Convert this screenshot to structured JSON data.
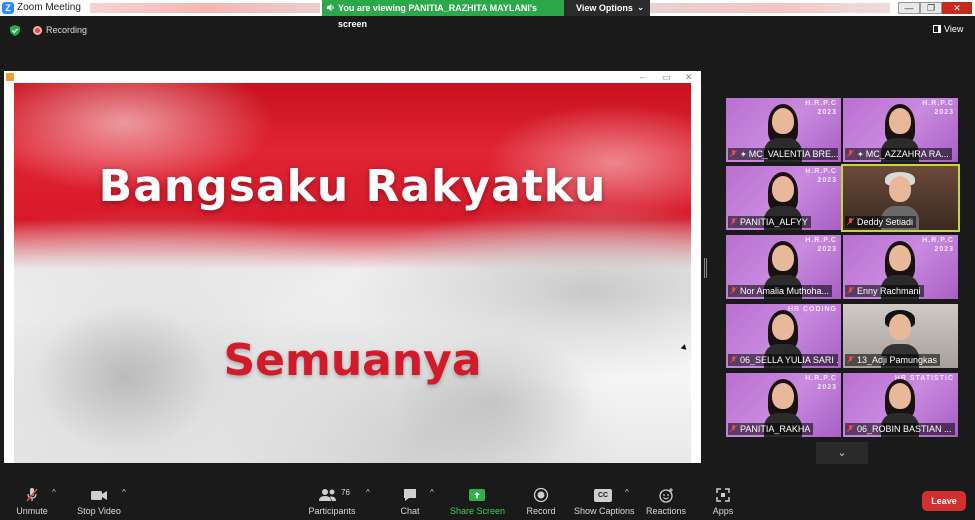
{
  "window": {
    "title": "Zoom Meeting",
    "logo_letter": "Z",
    "viewing_banner": "You are viewing PANITIA_RAZHITA MAYLANI's screen",
    "view_options": "View Options",
    "controls": {
      "minimize": "—",
      "restore": "❐",
      "close": "✕"
    }
  },
  "status": {
    "recording": "Recording",
    "view": "View"
  },
  "shared_screen": {
    "window_controls": {
      "minimize": "–",
      "restore": "▭",
      "close": "✕"
    },
    "headline": "Bangsaku Rakyatku",
    "subline": "Semuanya"
  },
  "gallery": [
    {
      "name": "MC_VALENTIA BRE...",
      "muted": true,
      "pinned": true,
      "mark": "H.R.P.C\n2023",
      "bg": "purple"
    },
    {
      "name": "MC_AZZAHRA RA...",
      "muted": true,
      "pinned": true,
      "mark": "H.R.P.C\n2023",
      "bg": "purple"
    },
    {
      "name": "PANITIA_ALFYY",
      "muted": true,
      "pinned": false,
      "mark": "H.R.P.C\n2023",
      "bg": "purple"
    },
    {
      "name": "Deddy Setiadi",
      "muted": true,
      "pinned": false,
      "mark": "",
      "bg": "real",
      "active_speaker": true
    },
    {
      "name": "Nor Amalia Muthoha...",
      "muted": true,
      "pinned": false,
      "mark": "H.R.P.C\n2023",
      "bg": "purple"
    },
    {
      "name": "Enny Rachmani",
      "muted": true,
      "pinned": false,
      "mark": "H.R.P.C\n2023",
      "bg": "purple"
    },
    {
      "name": "06_SELLA YULIA SARI ...",
      "muted": true,
      "pinned": false,
      "mark": "HR CODING",
      "bg": "purple"
    },
    {
      "name": "13_Adji Pamungkas",
      "muted": true,
      "pinned": false,
      "mark": "",
      "bg": "real2"
    },
    {
      "name": "PANITIA_RAKHA",
      "muted": true,
      "pinned": false,
      "mark": "H.R.P.C\n2023",
      "bg": "purple"
    },
    {
      "name": "06_ROBIN BASTIAN ...",
      "muted": true,
      "pinned": false,
      "mark": "HR STATISTIC",
      "bg": "purple"
    }
  ],
  "toolbar": {
    "unmute": "Unmute",
    "stop_video": "Stop Video",
    "participants": "Participants",
    "participants_count": "76",
    "chat": "Chat",
    "share_screen": "Share Screen",
    "record": "Record",
    "show_captions": "Show Captions",
    "cc": "CC",
    "reactions": "Reactions",
    "apps": "Apps",
    "leave": "Leave"
  },
  "colors": {
    "accent_green": "#2aa84a",
    "leave_red": "#d32f2f",
    "speaker_highlight": "#c8d63a",
    "tile_purple": "#b96fd0"
  }
}
